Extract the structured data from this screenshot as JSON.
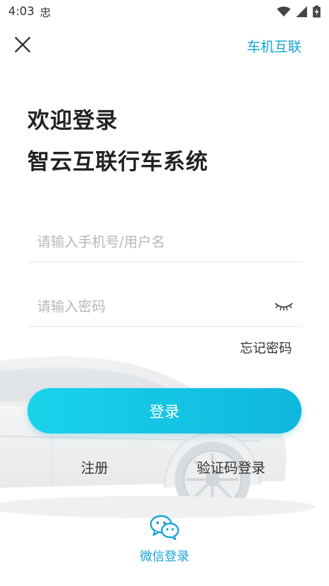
{
  "status_bar": {
    "time": "4:03",
    "extra": "忠"
  },
  "header": {
    "carlink_label": "车机互联"
  },
  "titles": {
    "welcome": "欢迎登录",
    "system_name": "智云互联行车系统"
  },
  "form": {
    "username_placeholder": "请输入手机号/用户名",
    "password_placeholder": "请输入密码",
    "forgot_label": "忘记密码",
    "login_label": "登录"
  },
  "links": {
    "register_label": "注册",
    "sms_login_label": "验证码登录"
  },
  "wechat": {
    "label": "微信登录"
  },
  "colors": {
    "accent": "#17a5d6",
    "button_start": "#19d3ea",
    "button_end": "#10b7dd"
  },
  "icons": {
    "close": "close-icon",
    "eye": "eye-closed-icon",
    "wechat": "wechat-icon",
    "wifi": "wifi-icon",
    "signal": "signal-icon",
    "battery": "battery-icon"
  }
}
